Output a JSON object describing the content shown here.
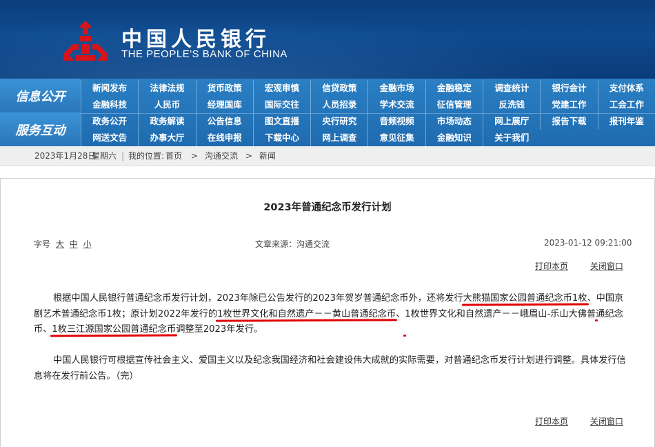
{
  "header": {
    "bank_name_cn": "中国人民银行",
    "bank_name_en": "THE PEOPLE'S BANK OF CHINA",
    "logo_icon": "pboc-emblem-icon",
    "colors": {
      "header_bg": "#0e4a8e",
      "logo_red": "#d7141a",
      "nav_bg": "#2676bb"
    }
  },
  "nav": {
    "section1_label": "信息公开",
    "section2_label": "服务互动",
    "rows": [
      [
        "新闻发布",
        "法律法规",
        "货币政策",
        "宏观审慎",
        "信贷政策",
        "金融市场",
        "金融稳定",
        "调查统计",
        "银行会计",
        "支付体系"
      ],
      [
        "金融科技",
        "人民币",
        "经理国库",
        "国际交往",
        "人员招录",
        "学术交流",
        "征信管理",
        "反洗钱",
        "党建工作",
        "工会工作"
      ],
      [
        "政务公开",
        "政务解读",
        "公告信息",
        "图文直播",
        "央行研究",
        "音频视频",
        "市场动态",
        "网上展厅",
        "报告下载",
        "报刊年鉴"
      ],
      [
        "网送文告",
        "办事大厅",
        "在线申报",
        "下载中心",
        "网上调查",
        "意见征集",
        "金融知识",
        "关于我们"
      ]
    ]
  },
  "breadcrumb": {
    "date": "2023年1月28日",
    "weekday": "星期六",
    "location_label": "我的位置:",
    "home": "首页",
    "section": "沟通交流",
    "current": "新闻",
    "sep": ">"
  },
  "article": {
    "title": "2023年普通纪念币发行计划",
    "font_size_label": "字号",
    "font_large": "大",
    "font_medium": "中",
    "font_small": "小",
    "source": "文章来源：沟通交流",
    "datetime": "2023-01-12  09:21:00",
    "print_label": "打印本页",
    "close_label": "关闭窗口",
    "p1": [
      {
        "t": "根据中国人民银行普通纪念币发行计划，2023年除已公告发行的2023年贺岁普通纪念币外，还将发行",
        "u": false
      },
      {
        "t": "大熊猫国家公园普通纪念币1枚",
        "u": true
      },
      {
        "t": "、",
        "u": false
      },
      {
        "t": "中国京剧艺术普通纪念币1枚",
        "u": true
      },
      {
        "t": "；原计划2022年发行的",
        "u": false
      },
      {
        "t": "1枚世界文化和自然遗产－－黄山普通纪念币",
        "u": true
      },
      {
        "t": "、",
        "u": false
      },
      {
        "t": "1枚世界文化和自然遗产－－峨眉山-乐山大佛普通纪念币",
        "u": true
      },
      {
        "t": "、",
        "u": false
      },
      {
        "t": "1枚三江源国家公园普通纪念币",
        "u": true
      },
      {
        "t": "调整至2023年发行。",
        "u": false
      }
    ],
    "p2": "中国人民银行可根据宣传社会主义、爱国主义以及纪念我国经济和社会建设伟大成就的实际需要，对普通纪念币发行计划进行调整。具体发行信息将在发行前公告。（完）"
  }
}
